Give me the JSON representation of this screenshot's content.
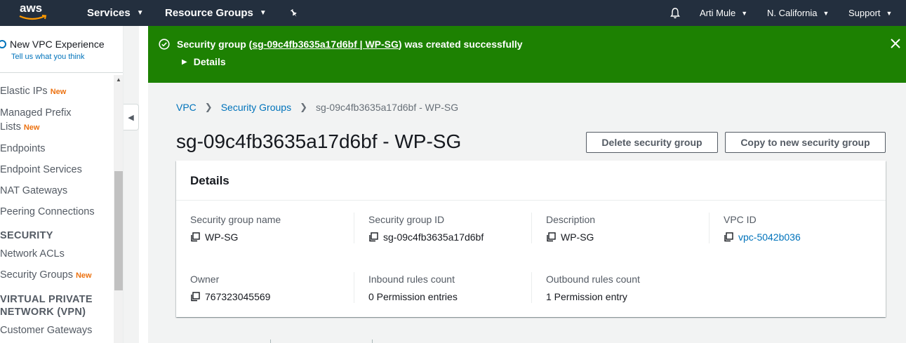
{
  "nav": {
    "logo": "aws",
    "services": "Services",
    "resource_groups": "Resource Groups",
    "user": "Arti Mule",
    "region": "N. California",
    "support": "Support"
  },
  "sidebar": {
    "new_vpc": "New VPC Experience",
    "tell_us": "Tell us what you think",
    "new_badge": "New",
    "items": {
      "elastic_ips": "Elastic IPs",
      "managed_prefix": "Managed Prefix",
      "lists": "Lists",
      "endpoints": "Endpoints",
      "endpoint_services": "Endpoint Services",
      "nat_gateways": "NAT Gateways",
      "peering": "Peering Connections",
      "security_section": "SECURITY",
      "network_acls": "Network ACLs",
      "security_groups": "Security Groups",
      "vpn_section_1": "VIRTUAL PRIVATE",
      "vpn_section_2": "NETWORK (VPN)",
      "customer_gateways": "Customer Gateways"
    }
  },
  "flash": {
    "prefix": "Security group (",
    "link": "sg-09c4fb3635a17d6bf | WP-SG",
    "suffix": ") was created successfully",
    "details": "Details",
    "color": "#1d8102"
  },
  "breadcrumb": {
    "vpc": "VPC",
    "security_groups": "Security Groups",
    "current": "sg-09c4fb3635a17d6bf - WP-SG"
  },
  "page": {
    "title": "sg-09c4fb3635a17d6bf - WP-SG",
    "delete_button": "Delete security group",
    "copy_button": "Copy to new security group"
  },
  "details": {
    "title": "Details",
    "sg_name_label": "Security group name",
    "sg_name": "WP-SG",
    "sg_id_label": "Security group ID",
    "sg_id": "sg-09c4fb3635a17d6bf",
    "description_label": "Description",
    "description": "WP-SG",
    "vpc_id_label": "VPC ID",
    "vpc_id": "vpc-5042b036",
    "owner_label": "Owner",
    "owner": "767323045569",
    "inbound_label": "Inbound rules count",
    "inbound": "0 Permission entries",
    "outbound_label": "Outbound rules count",
    "outbound": "1 Permission entry"
  },
  "colors": {
    "nav_bg": "#232f3e",
    "link": "#0073bb",
    "badge_new": "#ec7211"
  }
}
